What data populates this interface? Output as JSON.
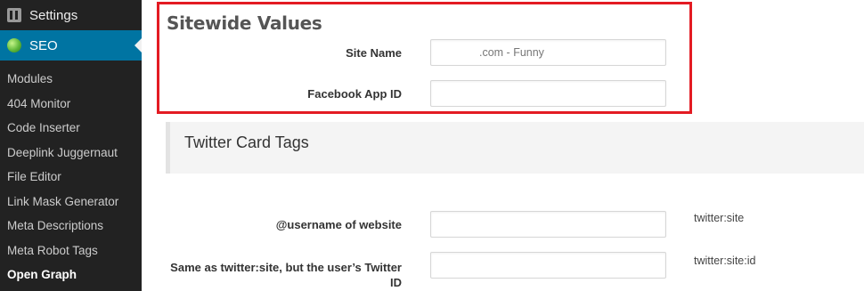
{
  "sidebar": {
    "settings_label": "Settings",
    "settings_icon": "settings-icon",
    "seo_label": "SEO",
    "seo_icon": "seo-icon",
    "submenu": [
      {
        "label": "Modules"
      },
      {
        "label": "404 Monitor"
      },
      {
        "label": "Code Inserter"
      },
      {
        "label": "Deeplink Juggernaut"
      },
      {
        "label": "File Editor"
      },
      {
        "label": "Link Mask Generator"
      },
      {
        "label": "Meta Descriptions"
      },
      {
        "label": "Meta Robot Tags"
      },
      {
        "label": "Open Graph",
        "active": true
      }
    ]
  },
  "sitewide": {
    "title": "Sitewide Values",
    "site_name_label": "Site Name",
    "site_name_value": ".com - Funny",
    "fb_app_id_label": "Facebook App ID",
    "fb_app_id_value": ""
  },
  "twitter": {
    "title": "Twitter Card Tags",
    "username_label": "@username of website",
    "username_value": "",
    "username_hint": "twitter:site",
    "user_id_label": "Same as twitter:site, but the user’s Twitter ID",
    "user_id_value": "",
    "user_id_hint": "twitter:site:id"
  },
  "colors": {
    "sidebar_bg": "#222222",
    "active_menu": "#0074a2",
    "highlight_border": "#e31b23"
  }
}
